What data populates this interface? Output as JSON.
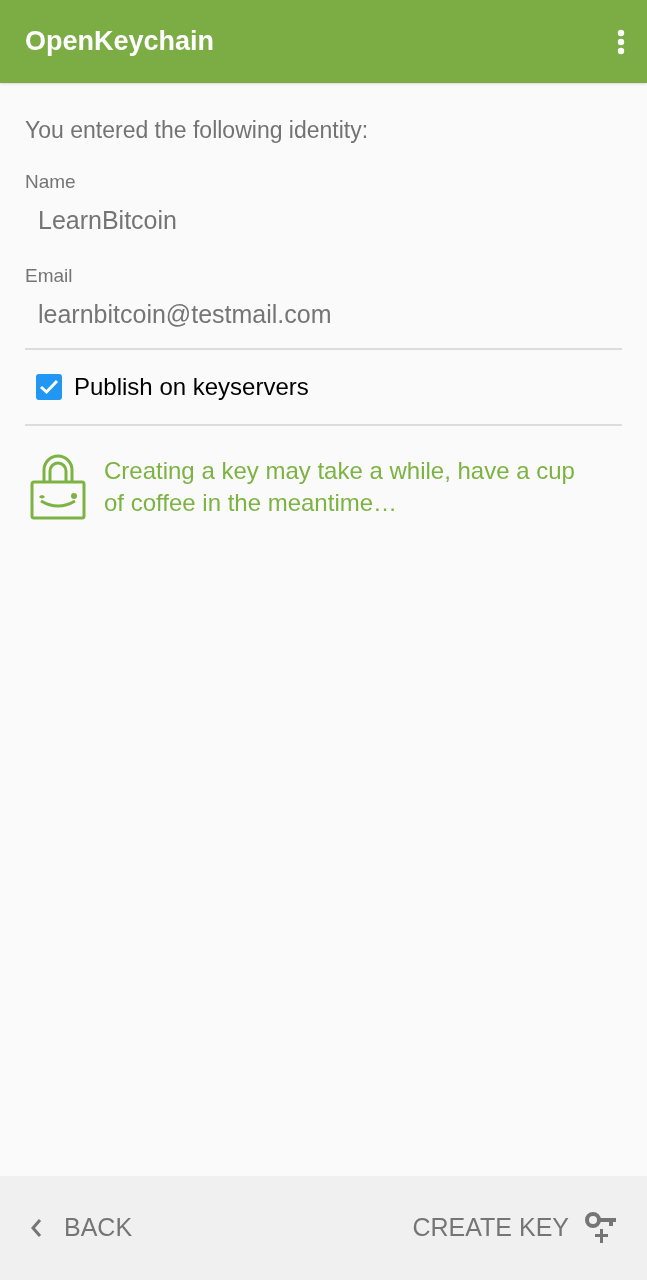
{
  "app_bar": {
    "title": "OpenKeychain"
  },
  "intro": "You entered the following identity:",
  "fields": [
    {
      "label": "Name",
      "value": "LearnBitcoin"
    },
    {
      "label": "Email",
      "value": "learnbitcoin@testmail.com"
    }
  ],
  "publish": {
    "label": "Publish on keyservers",
    "checked": true
  },
  "hint": "Creating a key may take a while, have a cup of coffee in the meantime…",
  "footer": {
    "back": "BACK",
    "create": "CREATE KEY"
  }
}
